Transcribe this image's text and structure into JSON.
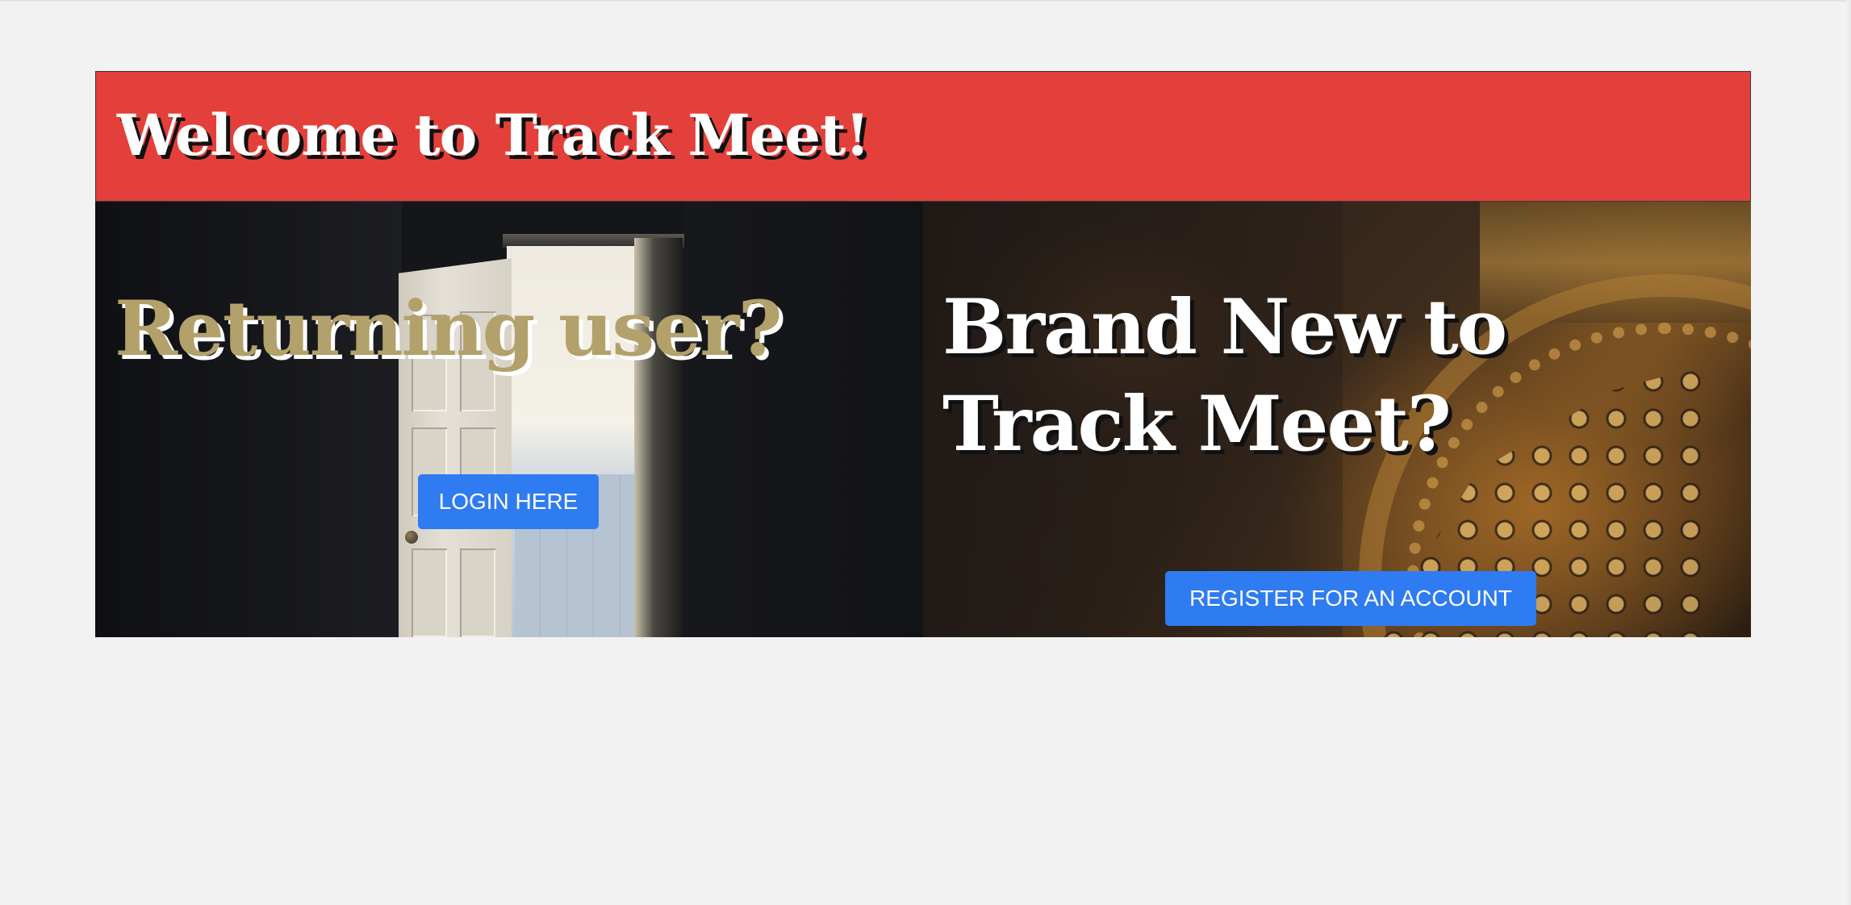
{
  "banner": {
    "title": "Welcome to Track Meet!"
  },
  "returning_panel": {
    "heading": "Returning user?",
    "button_label": "LOGIN HERE"
  },
  "new_user_panel": {
    "heading_line1": "Brand New to",
    "heading_line2": "Track Meet?",
    "button_label": "REGISTER FOR AN ACCOUNT"
  },
  "colors": {
    "banner_background": "#e4403b",
    "button_background": "#2f7bf1",
    "returning_heading_color": "#b3a16b",
    "page_background": "#f2f2f2"
  }
}
